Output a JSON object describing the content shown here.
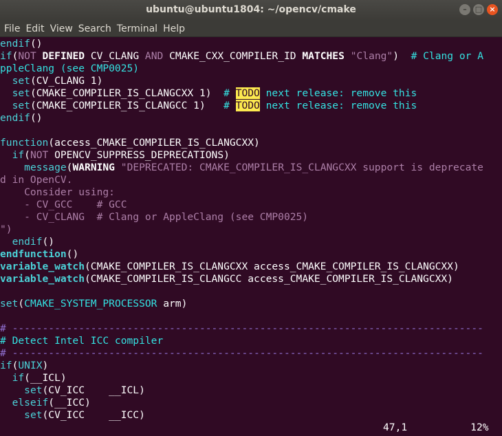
{
  "window": {
    "title": "ubuntu@ubuntu1804: ~/opencv/cmake",
    "controls": [
      "–",
      "□",
      "×"
    ]
  },
  "menu": [
    "File",
    "Edit",
    "View",
    "Search",
    "Terminal",
    "Help"
  ],
  "lines": [
    [
      [
        "endif",
        "k"
      ],
      [
        "()",
        "p"
      ]
    ],
    [
      [
        "if",
        "k"
      ],
      [
        "(",
        "p"
      ],
      [
        "NOT",
        "s"
      ],
      [
        " ",
        "p"
      ],
      [
        "DEFINED",
        "b"
      ],
      [
        " CV_CLANG ",
        "p"
      ],
      [
        "AND",
        "s"
      ],
      [
        " CMAKE_CXX_COMPILER_ID ",
        "p"
      ],
      [
        "MATCHES",
        "b"
      ],
      [
        " ",
        "p"
      ],
      [
        "\"Clang\"",
        "s"
      ],
      [
        ")  ",
        "p"
      ],
      [
        "# Clang or A",
        "c"
      ]
    ],
    [
      [
        "ppleClang (see CMP0025)",
        "c"
      ]
    ],
    [
      [
        "  ",
        "p"
      ],
      [
        "set",
        "k"
      ],
      [
        "(CV_CLANG 1)",
        "p"
      ]
    ],
    [
      [
        "  ",
        "p"
      ],
      [
        "set",
        "k"
      ],
      [
        "(CMAKE_COMPILER_IS_CLANGCXX 1)  ",
        "p"
      ],
      [
        "# ",
        "c"
      ],
      [
        "TODO",
        "t"
      ],
      [
        " next release: remove this",
        "c"
      ]
    ],
    [
      [
        "  ",
        "p"
      ],
      [
        "set",
        "k"
      ],
      [
        "(CMAKE_COMPILER_IS_CLANGCC 1)   ",
        "p"
      ],
      [
        "# ",
        "c"
      ],
      [
        "TODO",
        "t"
      ],
      [
        " next release: remove this",
        "c"
      ]
    ],
    [
      [
        "endif",
        "k"
      ],
      [
        "()",
        "p"
      ]
    ],
    [],
    [
      [
        "function",
        "k"
      ],
      [
        "(access_CMAKE_COMPILER_IS_CLANGCXX)",
        "p"
      ]
    ],
    [
      [
        "  ",
        "p"
      ],
      [
        "if",
        "k"
      ],
      [
        "(",
        "p"
      ],
      [
        "NOT",
        "s"
      ],
      [
        " OPENCV_SUPPRESS_DEPRECATIONS)",
        "p"
      ]
    ],
    [
      [
        "    ",
        "p"
      ],
      [
        "message",
        "k"
      ],
      [
        "(",
        "p"
      ],
      [
        "WARNING",
        "b"
      ],
      [
        " ",
        "p"
      ],
      [
        "\"DEPRECATED: CMAKE_COMPILER_IS_CLANGCXX support is deprecate",
        "s"
      ]
    ],
    [
      [
        "d in OpenCV.",
        "s"
      ]
    ],
    [
      [
        "    Consider using:",
        "s"
      ]
    ],
    [
      [
        "    - CV_GCC    # GCC",
        "s"
      ]
    ],
    [
      [
        "    - CV_CLANG  # Clang or AppleClang (see CMP0025)",
        "s"
      ]
    ],
    [
      [
        "\")",
        "s"
      ]
    ],
    [
      [
        "  ",
        "p"
      ],
      [
        "endif",
        "k"
      ],
      [
        "()",
        "p"
      ]
    ],
    [
      [
        "endfunction",
        "kb"
      ],
      [
        "()",
        "p"
      ]
    ],
    [
      [
        "variable_watch",
        "kb"
      ],
      [
        "(CMAKE_COMPILER_IS_CLANGCXX access_CMAKE_COMPILER_IS_CLANGCXX)",
        "p"
      ]
    ],
    [
      [
        "variable_watch",
        "kb"
      ],
      [
        "(CMAKE_COMPILER_IS_CLANGCC access_CMAKE_COMPILER_IS_CLANGCXX)",
        "p"
      ]
    ],
    [],
    [
      [
        "set",
        "k"
      ],
      [
        "(",
        "p"
      ],
      [
        "CMAKE_SYSTEM_PROCESSOR",
        "c"
      ],
      [
        " arm)",
        "p"
      ]
    ],
    [],
    [
      [
        "# ------------------------------------------------------------------------------",
        "d"
      ]
    ],
    [
      [
        "# Detect Intel ICC compiler",
        "c"
      ]
    ],
    [
      [
        "# ------------------------------------------------------------------------------",
        "d"
      ]
    ],
    [
      [
        "if",
        "k"
      ],
      [
        "(",
        "p"
      ],
      [
        "UNIX",
        "k"
      ],
      [
        ")",
        "p"
      ]
    ],
    [
      [
        "  ",
        "p"
      ],
      [
        "if",
        "k"
      ],
      [
        "(__ICL)",
        "p"
      ]
    ],
    [
      [
        "    ",
        "p"
      ],
      [
        "set",
        "k"
      ],
      [
        "(CV_ICC    __ICL)",
        "p"
      ]
    ],
    [
      [
        "  ",
        "p"
      ],
      [
        "elseif",
        "k"
      ],
      [
        "(__ICC)",
        "p"
      ]
    ],
    [
      [
        "    ",
        "p"
      ],
      [
        "set",
        "k"
      ],
      [
        "(CV_ICC    __ICC)",
        "p"
      ]
    ]
  ],
  "status": {
    "position": "47,1",
    "percent": "12%"
  }
}
